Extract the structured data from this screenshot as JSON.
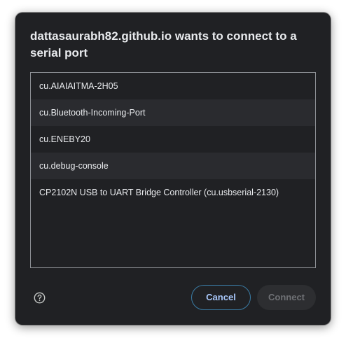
{
  "dialog": {
    "title": "dattasaurabh82.github.io wants to connect to a serial port",
    "ports": [
      {
        "label": "cu.AIAIAITMA-2H05"
      },
      {
        "label": "cu.Bluetooth-Incoming-Port"
      },
      {
        "label": "cu.ENEBY20"
      },
      {
        "label": "cu.debug-console"
      },
      {
        "label": "CP2102N USB to UART Bridge Controller (cu.usbserial-2130)"
      }
    ],
    "help_icon": "help-circle-icon",
    "cancel_label": "Cancel",
    "connect_label": "Connect",
    "connect_enabled": false
  },
  "colors": {
    "dialog_bg": "#202124",
    "text": "#e8eaed",
    "accent": "#a8c7fa",
    "cancel_border": "#3a7ca5",
    "disabled_text": "#6f7175"
  }
}
